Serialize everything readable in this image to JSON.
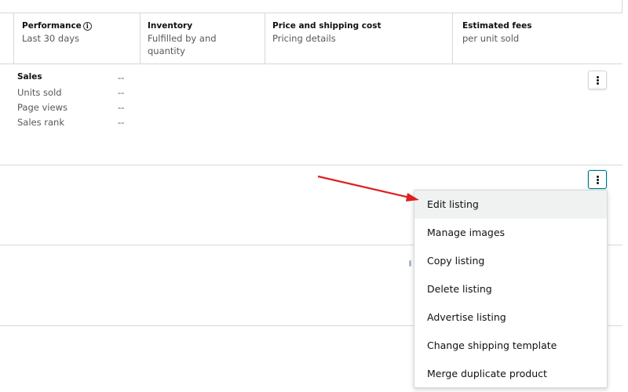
{
  "header": {
    "columns": [
      {
        "title": "Performance",
        "subtitle": "Last 30 days"
      },
      {
        "title": "Inventory",
        "subtitle": "Fulfilled by and quantity"
      },
      {
        "title": "Price and shipping cost",
        "subtitle": "Pricing details"
      },
      {
        "title": "Estimated fees",
        "subtitle": "per unit sold"
      }
    ]
  },
  "rows": [
    {
      "metrics": [
        {
          "label": "Sales",
          "value": "--"
        },
        {
          "label": "Units sold",
          "value": "--"
        },
        {
          "label": "Page views",
          "value": "--"
        },
        {
          "label": "Sales rank",
          "value": "--"
        }
      ]
    }
  ],
  "menu": {
    "items": [
      "Edit listing",
      "Manage images",
      "Copy listing",
      "Delete listing",
      "Advertise listing",
      "Change shipping template",
      "Merge duplicate product"
    ]
  },
  "icons": {
    "info": "info-icon",
    "kebab": "more-options-icon"
  },
  "colors": {
    "arrow": "#e02020",
    "border": "#d5d9d9",
    "active_border": "#007185"
  }
}
